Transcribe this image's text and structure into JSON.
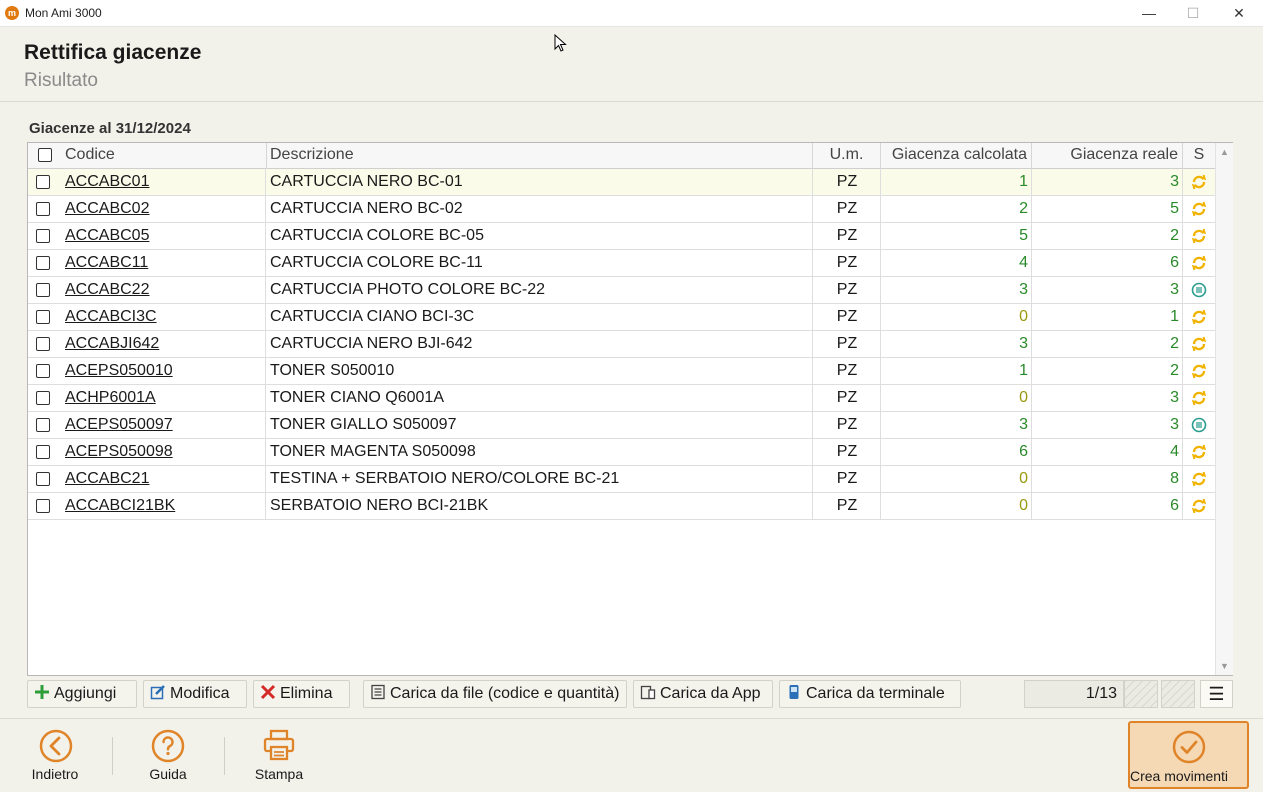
{
  "window": {
    "title": "Mon Ami 3000",
    "minimize": "—",
    "maximize": "☐",
    "close": "✕"
  },
  "header": {
    "title": "Rettifica giacenze",
    "subtitle": "Risultato"
  },
  "section": {
    "title": "Giacenze al 31/12/2024"
  },
  "table": {
    "columns": {
      "code": "Codice",
      "description": "Descrizione",
      "um": "U.m.",
      "calc": "Giacenza calcolata",
      "real": "Giacenza reale",
      "s": "S"
    },
    "rows": [
      {
        "code": "ACCABC01",
        "description": "CARTUCCIA NERO BC-01",
        "um": "PZ",
        "calc": "1",
        "real": "3",
        "status": "rettifica"
      },
      {
        "code": "ACCABC02",
        "description": "CARTUCCIA NERO BC-02",
        "um": "PZ",
        "calc": "2",
        "real": "5",
        "status": "rettifica"
      },
      {
        "code": "ACCABC05",
        "description": "CARTUCCIA COLORE BC-05",
        "um": "PZ",
        "calc": "5",
        "real": "2",
        "status": "rettifica"
      },
      {
        "code": "ACCABC11",
        "description": "CARTUCCIA COLORE BC-11",
        "um": "PZ",
        "calc": "4",
        "real": "6",
        "status": "rettifica"
      },
      {
        "code": "ACCABC22",
        "description": "CARTUCCIA PHOTO COLORE BC-22",
        "um": "PZ",
        "calc": "3",
        "real": "3",
        "status": "uguale"
      },
      {
        "code": "ACCABCI3C",
        "description": "CARTUCCIA CIANO BCI-3C",
        "um": "PZ",
        "calc": "0",
        "real": "1",
        "status": "rettifica"
      },
      {
        "code": "ACCABJI642",
        "description": "CARTUCCIA NERO BJI-642",
        "um": "PZ",
        "calc": "3",
        "real": "2",
        "status": "rettifica"
      },
      {
        "code": "ACEPS050010",
        "description": "TONER S050010",
        "um": "PZ",
        "calc": "1",
        "real": "2",
        "status": "rettifica"
      },
      {
        "code": "ACHP6001A",
        "description": "TONER CIANO Q6001A",
        "um": "PZ",
        "calc": "0",
        "real": "3",
        "status": "rettifica"
      },
      {
        "code": "ACEPS050097",
        "description": "TONER GIALLO S050097",
        "um": "PZ",
        "calc": "3",
        "real": "3",
        "status": "uguale"
      },
      {
        "code": "ACEPS050098",
        "description": "TONER MAGENTA S050098",
        "um": "PZ",
        "calc": "6",
        "real": "4",
        "status": "rettifica"
      },
      {
        "code": "ACCABC21",
        "description": "TESTINA + SERBATOIO NERO/COLORE BC-21",
        "um": "PZ",
        "calc": "0",
        "real": "8",
        "status": "rettifica"
      },
      {
        "code": "ACCABCI21BK",
        "description": "SERBATOIO NERO BCI-21BK",
        "um": "PZ",
        "calc": "0",
        "real": "6",
        "status": "rettifica"
      }
    ]
  },
  "toolbar": {
    "add": "Aggiungi",
    "edit": "Modifica",
    "delete": "Elimina",
    "load_file": "Carica da file (codice e quantità)",
    "load_app": "Carica da App",
    "load_terminal": "Carica da terminale",
    "pager": "1/13",
    "menu": "☰"
  },
  "bottombar": {
    "back": "Indietro",
    "help": "Guida",
    "print": "Stampa",
    "create": "Crea movimenti"
  },
  "colors": {
    "accent": "#e0842a",
    "green": "#2a8a2a",
    "zero": "#9a9a10",
    "teal": "#2a9d8f"
  }
}
